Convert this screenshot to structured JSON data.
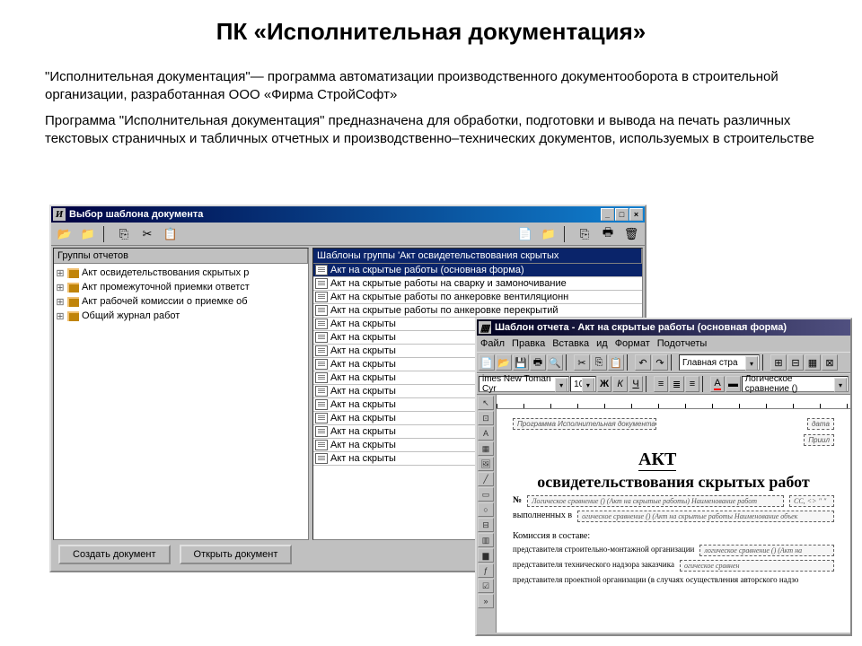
{
  "slide": {
    "title": "ПК «Исполнительная документация»",
    "p1": "\"Исполнительная документация\"— программа автоматизации производственного документооборота в строительной организации, разработанная ООО «Фирма СтройСофт»",
    "p2": "Программа \"Исполнительная документация\" предназначена для обработки, подготовки и вывода на печать различных текстовых страничных и табличных отчетных и производственно–технических документов, используемых в строительстве"
  },
  "win1": {
    "title": "Выбор шаблона документа",
    "left_header": "Группы отчетов",
    "right_header": "Шаблоны группы 'Акт освидетельствования скрытых",
    "groups": [
      "Акт освидетельствования скрытых р",
      "Акт промежуточной приемки ответст",
      "Акт рабочей комиссии о приемке об",
      "Общий журнал работ"
    ],
    "templates": [
      "Акт на скрытые работы (основная форма)",
      "Акт на скрытые работы на сварку и замоночивание",
      "Акт на скрытые работы по анкеровке вентиляционн",
      "Акт на скрытые работы по анкеровке перекрытий",
      "Акт на скрыты",
      "Акт на скрыты",
      "Акт на скрыты",
      "Акт на скрыты",
      "Акт на скрыты",
      "Акт на скрыты",
      "Акт на скрыты",
      "Акт на скрыты",
      "Акт на скрыты",
      "Акт на скрыты",
      "Акт на скрыты"
    ],
    "buttons": {
      "create": "Создать документ",
      "open": "Открыть документ"
    }
  },
  "win2": {
    "title": "Шаблон отчета - Акт на скрытые работы (основная форма)",
    "menu": [
      "Файл",
      "Правка",
      "Вставка",
      "ид",
      "Формат",
      "Подотчеты"
    ],
    "toolbar2": {
      "page_combo": "Главная стра"
    },
    "toolbar3": {
      "font": "imes New Toman Cyr",
      "size": "10",
      "combo2": "Логическое сравнение ()"
    },
    "doc": {
      "top_left": "Программа Исполнительная документация",
      "appendix": "Приил",
      "title": "АКТ",
      "subtitle": "освидетельствования скрытых работ",
      "row1_a": "Логическое сравнение () (Акт на скрытые работы) Наименование работ",
      "row1_b": "СС, <> \" \"",
      "row2_a": "выполненных в",
      "row2_b": "огическое сравнение () (Акт на скрытые работы Наименование объек",
      "committee": "Комиссия в составе:",
      "r1": "представителя строительно-монтажной организации",
      "r1_box": "логическое сравнение () (Акт на",
      "r2": "представителя технического надзора заказчика",
      "r2_box": "огическое сравнен",
      "r3": "представителя проектной организации (в случаях осуществления авторского надзо"
    }
  }
}
